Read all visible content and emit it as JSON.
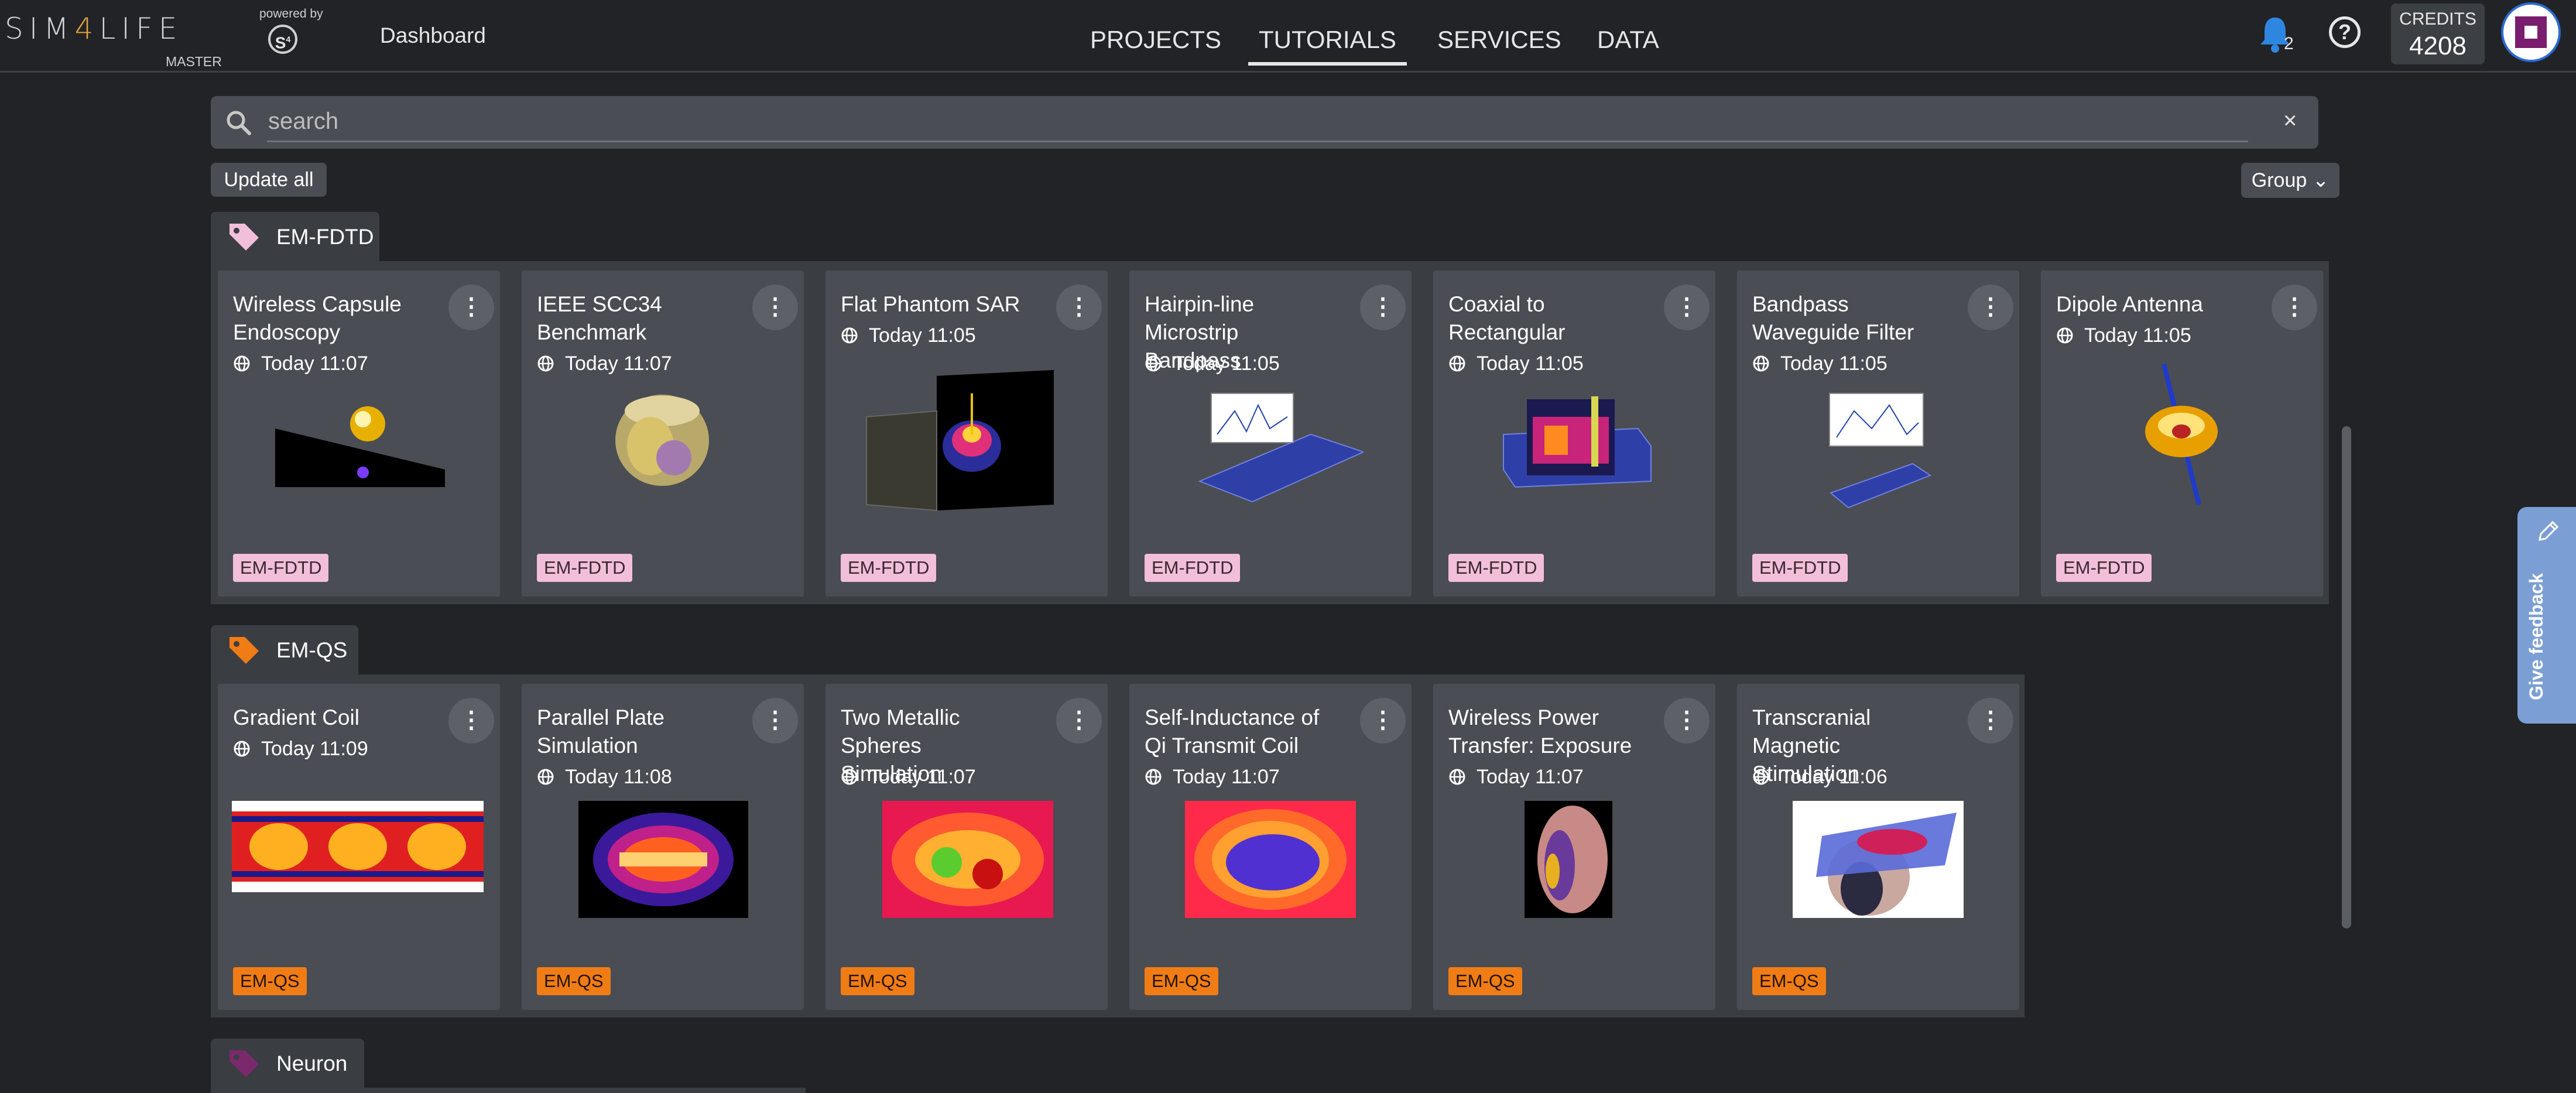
{
  "header": {
    "logo_prefix": "SIM",
    "logo_number": "4",
    "logo_suffix": "LIFE",
    "logo_sub": "MASTER",
    "powered_by": "powered by",
    "brand_mark": "S",
    "brand_mark_sup": "4",
    "dashboard": "Dashboard",
    "nav": [
      "PROJECTS",
      "TUTORIALS",
      "SERVICES",
      "DATA"
    ],
    "active_nav": "TUTORIALS",
    "notifications_count": "2",
    "help_symbol": "?",
    "credits_label": "CREDITS",
    "credits_value": "4208"
  },
  "toolbar": {
    "search_placeholder": "search",
    "clear_symbol": "×",
    "update_all": "Update all",
    "group": "Group ⌄"
  },
  "card_menu_symbol": "⋮",
  "sections": [
    {
      "name": "EM-FDTD",
      "tag_color": "#f2bfd8",
      "cards": [
        {
          "title": "Wireless Capsule Endoscopy",
          "time": "Today 11:07",
          "badge": "EM-FDTD"
        },
        {
          "title": "IEEE SCC34 Benchmark",
          "time": "Today 11:07",
          "badge": "EM-FDTD"
        },
        {
          "title": "Flat Phantom SAR",
          "time": "Today 11:05",
          "badge": "EM-FDTD"
        },
        {
          "title": "Hairpin-line Microstrip Bandpass",
          "time": "Today 11:05",
          "badge": "EM-FDTD"
        },
        {
          "title": "Coaxial to Rectangular",
          "time": "Today 11:05",
          "badge": "EM-FDTD"
        },
        {
          "title": "Bandpass Waveguide Filter",
          "time": "Today 11:05",
          "badge": "EM-FDTD"
        },
        {
          "title": "Dipole Antenna",
          "time": "Today 11:05",
          "badge": "EM-FDTD"
        }
      ]
    },
    {
      "name": "EM-QS",
      "tag_color": "#f07c16",
      "cards": [
        {
          "title": "Gradient Coil",
          "time": "Today 11:09",
          "badge": "EM-QS"
        },
        {
          "title": "Parallel Plate Simulation",
          "time": "Today 11:08",
          "badge": "EM-QS"
        },
        {
          "title": "Two Metallic Spheres Simulation",
          "time": "Today 11:07",
          "badge": "EM-QS"
        },
        {
          "title": "Self-Inductance of Qi Transmit Coil",
          "time": "Today 11:07",
          "badge": "EM-QS"
        },
        {
          "title": "Wireless Power Transfer: Exposure",
          "time": "Today 11:07",
          "badge": "EM-QS"
        },
        {
          "title": "Transcranial Magnetic Stimulation",
          "time": "Today 11:06",
          "badge": "EM-QS"
        }
      ]
    },
    {
      "name": "Neuron",
      "tag_color": "#7a2a6c",
      "cards": []
    }
  ],
  "feedback": {
    "label": "Give feedback"
  },
  "icons": {
    "notifications": "bell-icon",
    "help": "help-icon",
    "search": "search-icon",
    "tag": "tag-icon",
    "globe": "globe-icon",
    "menu": "kebab-menu-icon",
    "feedback": "pencil-icon"
  }
}
